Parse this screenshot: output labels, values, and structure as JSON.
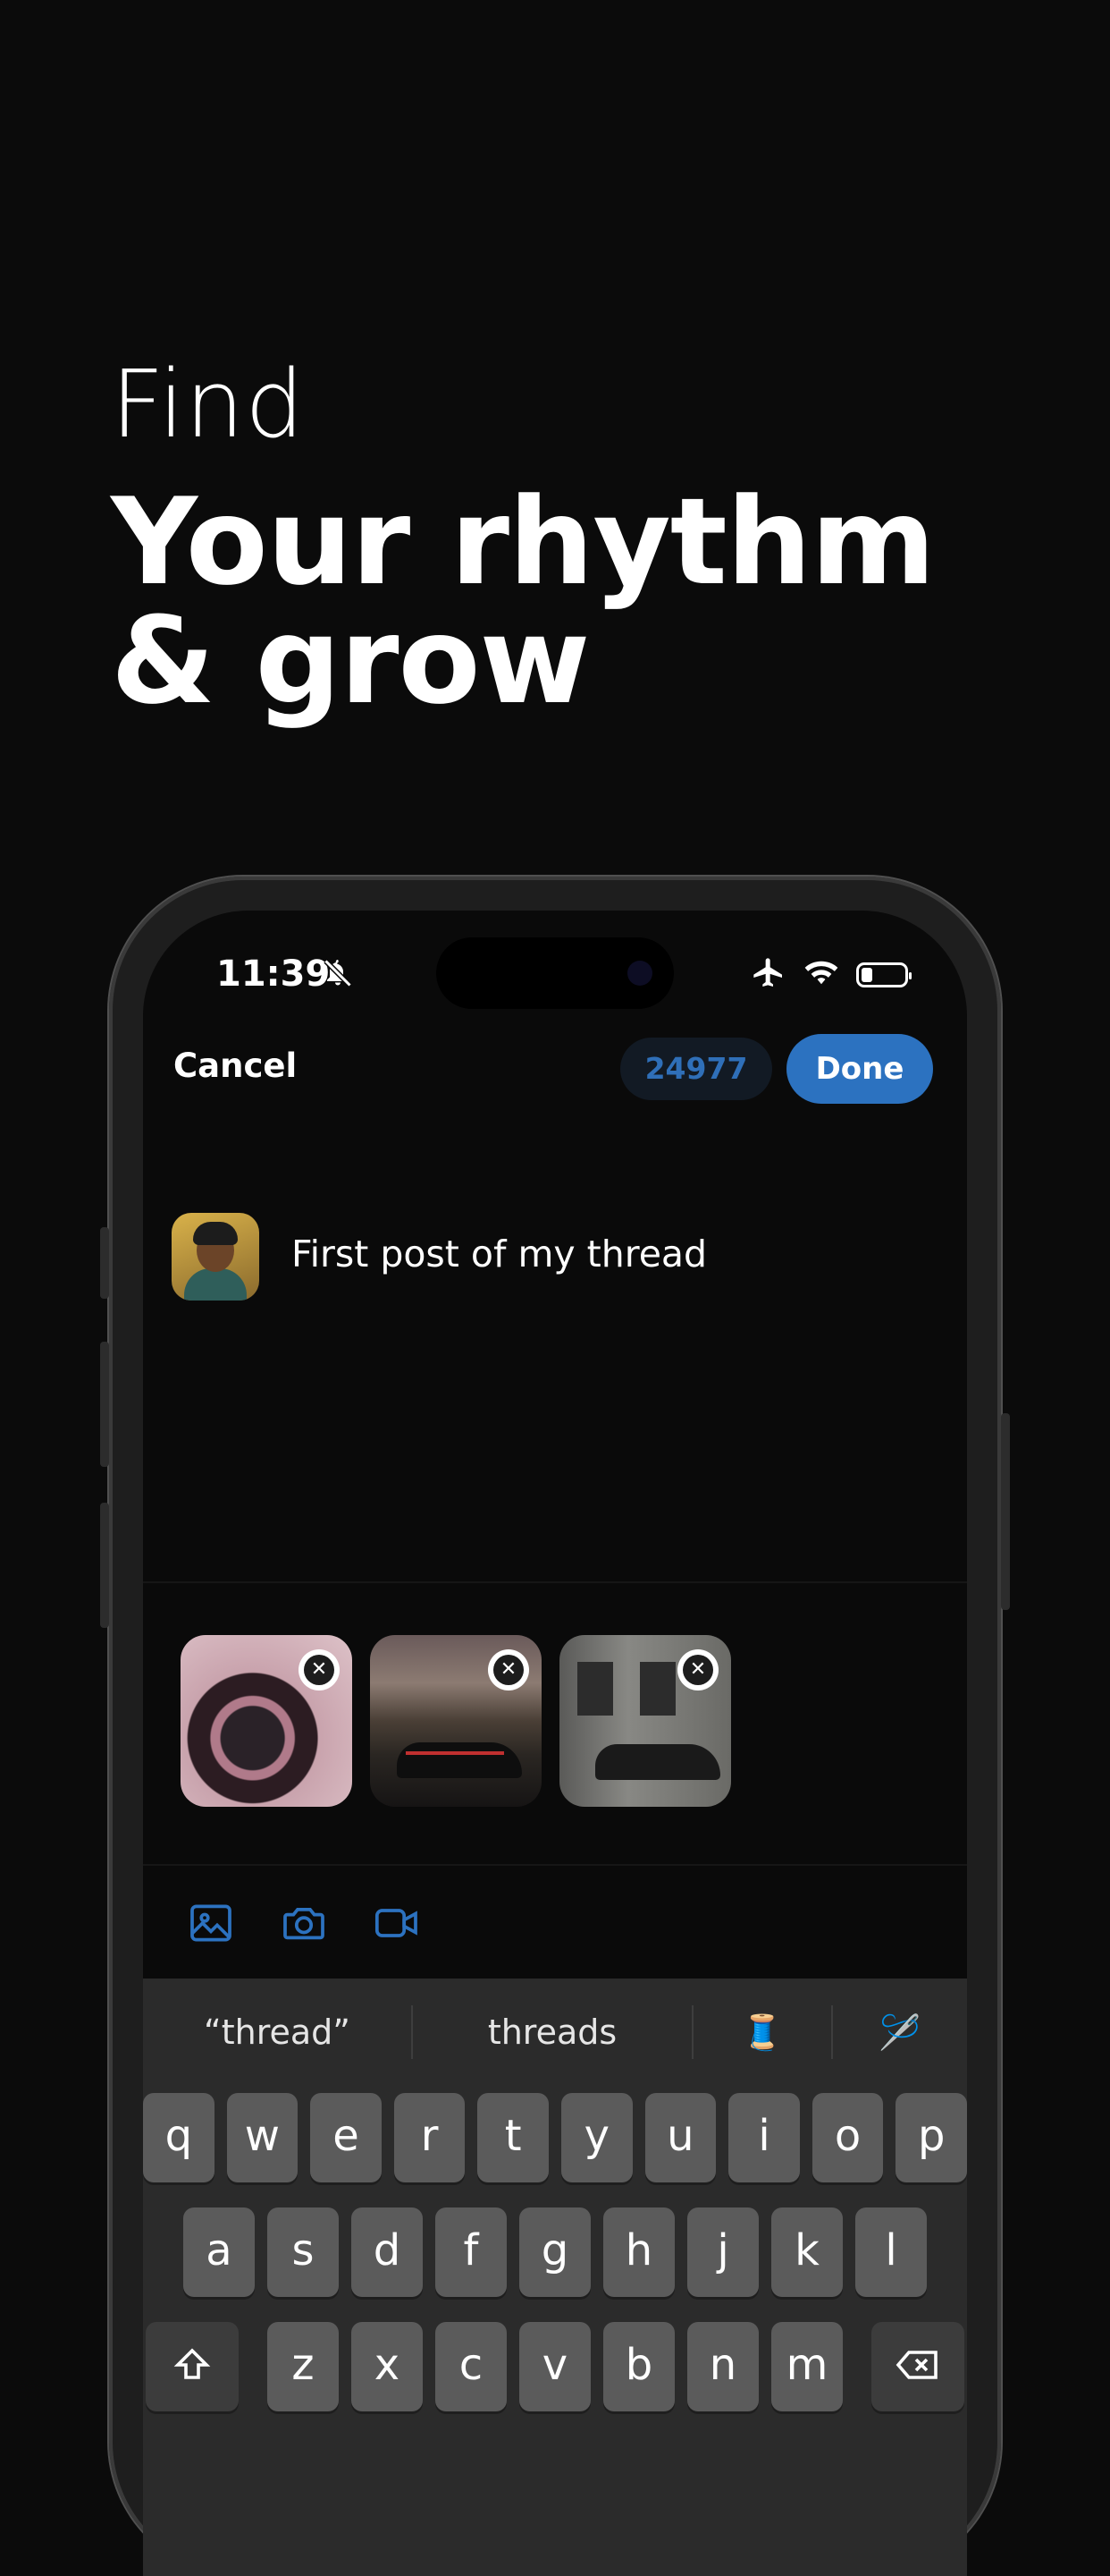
{
  "headline": {
    "line1": "Find",
    "line2": "Your rhythm",
    "line3": "& grow"
  },
  "status_bar": {
    "time": "11:39",
    "icons": [
      "bell-slash-icon",
      "airplane-icon",
      "wifi-icon",
      "battery-icon"
    ]
  },
  "topbar": {
    "cancel_label": "Cancel",
    "char_count": "24977",
    "done_label": "Done"
  },
  "post": {
    "text": "First post of my thread"
  },
  "media": {
    "thumbnails": [
      "steering-wheel-photo",
      "car-sunset-photo",
      "car-street-photo"
    ]
  },
  "toolbar": {
    "icons": [
      "image-icon",
      "camera-icon",
      "video-icon"
    ]
  },
  "keyboard": {
    "suggestions": [
      "“thread”",
      "threads",
      "🧵",
      "🪡"
    ],
    "row1": [
      "q",
      "w",
      "e",
      "r",
      "t",
      "y",
      "u",
      "i",
      "o",
      "p"
    ],
    "row2": [
      "a",
      "s",
      "d",
      "f",
      "g",
      "h",
      "j",
      "k",
      "l"
    ],
    "row3": [
      "z",
      "x",
      "c",
      "v",
      "b",
      "n",
      "m"
    ]
  },
  "colors": {
    "accent": "#2c72c0",
    "background": "#0b0b0b"
  }
}
